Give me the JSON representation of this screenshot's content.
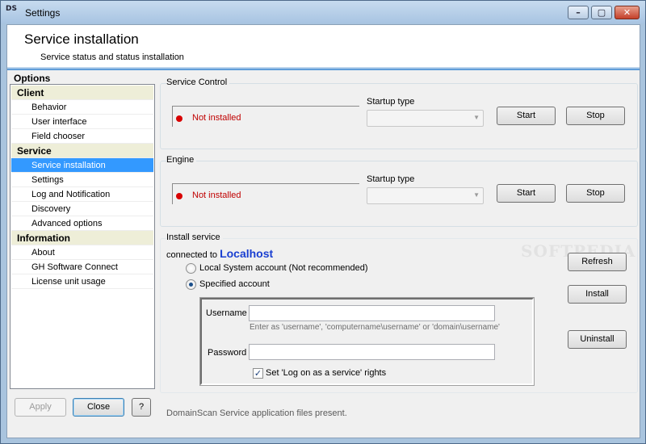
{
  "window": {
    "icon_text": "DS",
    "title": "Settings",
    "minimize_glyph": "–",
    "maximize_glyph": "▢",
    "close_glyph": "✕"
  },
  "header": {
    "title": "Service installation",
    "subtitle": "Service status and status installation"
  },
  "sidebar": {
    "title": "Options",
    "groups": [
      {
        "label": "Client",
        "items": [
          "Behavior",
          "User interface",
          "Field chooser"
        ]
      },
      {
        "label": "Service",
        "items": [
          "Service installation",
          "Settings",
          "Log and Notification",
          "Discovery",
          "Advanced options"
        ]
      },
      {
        "label": "Information",
        "items": [
          "About",
          "GH Software Connect",
          "License unit usage"
        ]
      }
    ],
    "selected_item": "Service installation"
  },
  "footer_buttons": {
    "apply": "Apply",
    "close": "Close",
    "help": "?"
  },
  "service_control": {
    "label": "Service Control",
    "status": "Not installed",
    "startup_type_label": "Startup type",
    "startup_type_value": "",
    "start": "Start",
    "stop": "Stop"
  },
  "engine": {
    "label": "Engine",
    "status": "Not installed",
    "startup_type_label": "Startup type",
    "startup_type_value": "",
    "start": "Start",
    "stop": "Stop"
  },
  "install_service": {
    "label": "Install service",
    "connected_prefix": "connected to",
    "connected_host": "Localhost",
    "local_system": "Local System account (Not recommended)",
    "specified_account": "Specified account",
    "selected_account": "Specified account",
    "username_label": "Username",
    "username_value": "",
    "username_hint": "Enter as 'username', 'computername\\username' or 'domain\\username'",
    "password_label": "Password",
    "password_value": "",
    "logon_right": "Set 'Log on as a service' rights",
    "logon_right_checked": true,
    "refresh": "Refresh",
    "install": "Install",
    "uninstall": "Uninstall"
  },
  "status_message": "DomainScan Service application files present.",
  "watermark": "SOFTPEDIA",
  "colors": {
    "accent": "#3399ff",
    "status_red": "#d80000",
    "host_blue": "#1a3fd1",
    "group_header": "#eeeed8"
  }
}
